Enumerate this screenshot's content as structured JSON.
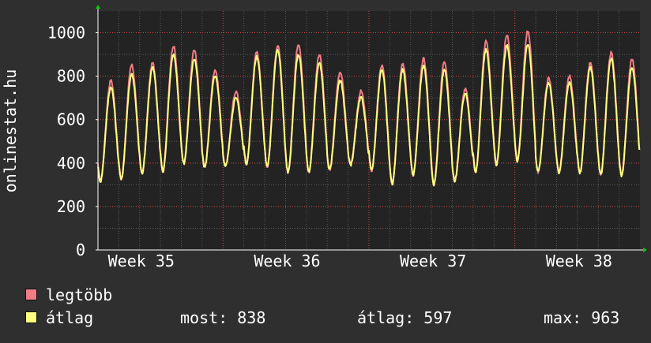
{
  "chart_data": {
    "type": "line",
    "ylabel": "onlinestat.hu",
    "ylim": [
      0,
      1100
    ],
    "y_ticks": [
      0,
      200,
      400,
      600,
      800,
      1000
    ],
    "x_tick_labels": [
      "Week 35",
      "Week 36",
      "Week 37",
      "Week 38"
    ],
    "grid": true,
    "days": 26,
    "series": [
      {
        "name": "legtöbb",
        "color": "#f07c84",
        "daily_peaks": [
          780,
          850,
          860,
          940,
          920,
          830,
          730,
          910,
          940,
          950,
          900,
          820,
          730,
          850,
          860,
          880,
          870,
          740,
          960,
          990,
          1010,
          790,
          800,
          860,
          910,
          880
        ]
      },
      {
        "name": "átlag",
        "color": "#ffff80",
        "daily_peaks": [
          750,
          810,
          840,
          900,
          880,
          800,
          700,
          890,
          920,
          900,
          860,
          780,
          700,
          830,
          830,
          850,
          830,
          720,
          920,
          940,
          950,
          770,
          770,
          840,
          880,
          840
        ]
      }
    ],
    "daily_lows": [
      315,
      320,
      350,
      355,
      400,
      380,
      385,
      395,
      385,
      355,
      355,
      365,
      395,
      375,
      295,
      350,
      300,
      315,
      350,
      390,
      415,
      360,
      355,
      355,
      345,
      340
    ]
  },
  "legend": {
    "max_label": "legtöbb",
    "avg_label": "átlag",
    "stat_now": "most: 838",
    "stat_avg": "átlag: 597",
    "stat_max": "max: 963"
  },
  "colors": {
    "background": "#2f2f2f",
    "plot_bg": "#232323",
    "grid_minor": "#5a5a5a",
    "grid_major": "#d24a4a",
    "axis": "#ffffff",
    "arrow": "#00cc00"
  }
}
